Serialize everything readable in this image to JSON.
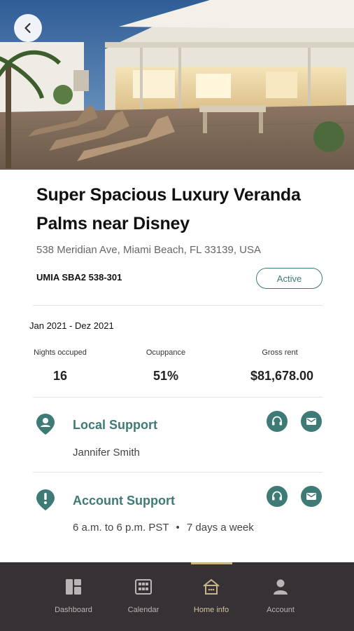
{
  "listing": {
    "title": "Super Spacious Luxury Veranda Palms near Disney",
    "address": "538 Meridian Ave, Miami Beach, FL 33139, USA",
    "code": "UMIA SBA2 538-301",
    "status": "Active"
  },
  "stats": {
    "period": "Jan 2021 - Dez 2021",
    "items": [
      {
        "label": "Nights occuped",
        "value": "16"
      },
      {
        "label": "Ocuppance",
        "value": "51%"
      },
      {
        "label": "Gross rent",
        "value": "$81,678.00"
      }
    ]
  },
  "local_support": {
    "title": "Local Support",
    "name": "Jannifer Smith"
  },
  "account_support": {
    "title": "Account Support",
    "hours": "6 a.m. to 6 p.m. PST",
    "days": "7 days a week"
  },
  "nav": {
    "items": [
      {
        "label": "Dashboard",
        "icon": "dashboard-icon"
      },
      {
        "label": "Calendar",
        "icon": "calendar-icon"
      },
      {
        "label": "Home info",
        "icon": "home-icon",
        "active": true
      },
      {
        "label": "Account",
        "icon": "account-icon"
      }
    ]
  },
  "colors": {
    "accent": "#3e7a76",
    "nav_bg": "#363134",
    "nav_active": "#c9b487"
  }
}
